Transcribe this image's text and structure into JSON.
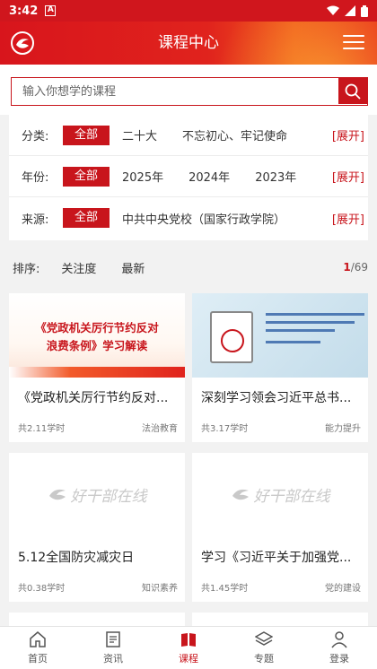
{
  "status_bar": {
    "time": "3:42",
    "notif_badge": "A"
  },
  "header": {
    "title": "课程中心"
  },
  "search": {
    "placeholder": "输入你想学的课程"
  },
  "filters": [
    {
      "label": "分类:",
      "selected": "全部",
      "options": [
        "二十大",
        "不忘初心、牢记使命"
      ],
      "expand": "[展开]"
    },
    {
      "label": "年份:",
      "selected": "全部",
      "options": [
        "2025年",
        "2024年",
        "2023年"
      ],
      "expand": "[展开]"
    },
    {
      "label": "来源:",
      "selected": "全部",
      "options": [
        "中共中央党校（国家行政学院）"
      ],
      "expand": "[展开]"
    }
  ],
  "sort": {
    "label": "排序:",
    "options": [
      "关注度",
      "最新"
    ],
    "page_current": "1",
    "page_total": "/69"
  },
  "courses": [
    {
      "title": "《党政机关厉行节约反对...",
      "hours": "共2.11学时",
      "tag": "法治教育",
      "thumb_text_1": "《党政机关厉行节约反对",
      "thumb_text_2": "浪费条例》学习解读"
    },
    {
      "title": "深刻学习领会习近平总书...",
      "hours": "共3.17学时",
      "tag": "能力提升"
    },
    {
      "title": "5.12全国防灾减灾日",
      "hours": "共0.38学时",
      "tag": "知识素养",
      "watermark": "好干部在线"
    },
    {
      "title": "学习《习近平关于加强党...",
      "hours": "共1.45学时",
      "tag": "党的建设",
      "watermark": "好干部在线"
    }
  ],
  "tabbar": [
    {
      "label": "首页",
      "icon": "home-icon"
    },
    {
      "label": "资讯",
      "icon": "news-icon"
    },
    {
      "label": "课程",
      "icon": "course-book-icon",
      "active": true
    },
    {
      "label": "专题",
      "icon": "layers-icon"
    },
    {
      "label": "登录",
      "icon": "user-icon"
    }
  ],
  "colors": {
    "brand_red": "#c8151c",
    "header_red": "#d8151c"
  }
}
